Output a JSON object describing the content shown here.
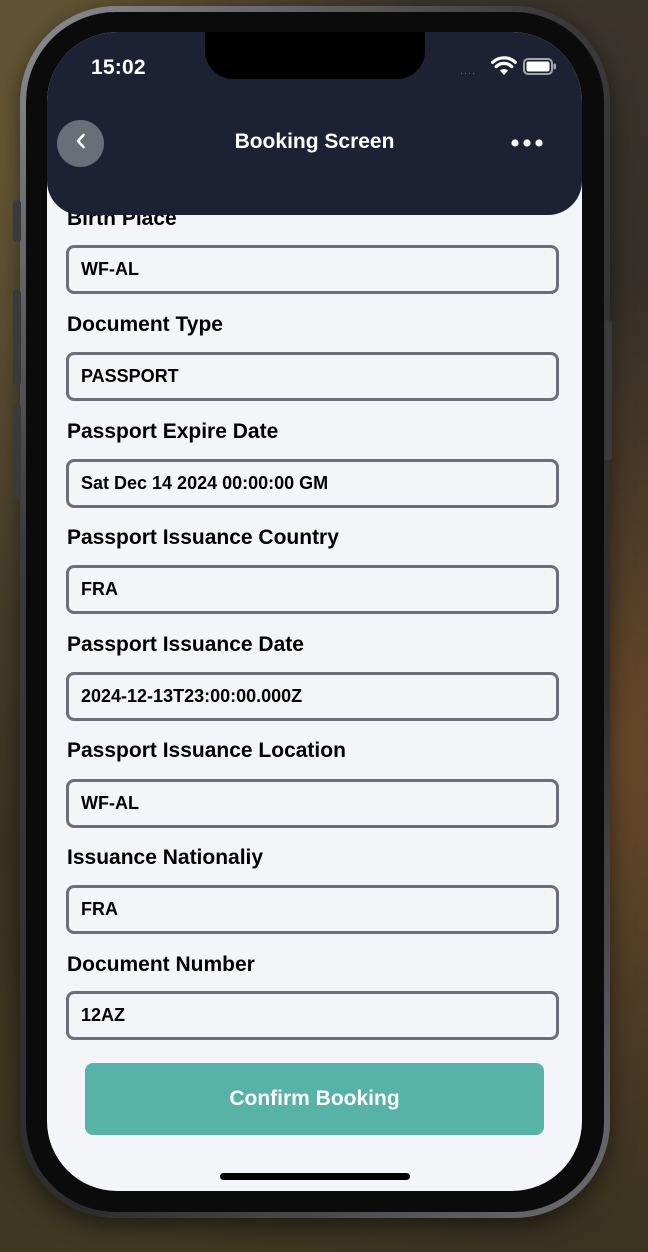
{
  "status_bar": {
    "time": "15:02",
    "signal": "....",
    "wifi_icon": "wifi-icon",
    "battery_icon": "battery-icon"
  },
  "header": {
    "title": "Booking Screen",
    "back_icon": "chevron-left-icon",
    "more_icon": "ellipsis-icon",
    "background_color": "#1c2133"
  },
  "form": {
    "fields": [
      {
        "label": "Birth Place",
        "value": "WF-AL"
      },
      {
        "label": "Document Type",
        "value": "PASSPORT"
      },
      {
        "label": "Passport Expire Date",
        "value": "Sat Dec 14 2024 00:00:00 GM"
      },
      {
        "label": "Passport Issuance Country",
        "value": "FRA"
      },
      {
        "label": "Passport Issuance Date",
        "value": "2024-12-13T23:00:00.000Z"
      },
      {
        "label": "Passport Issuance Location",
        "value": "WF-AL"
      },
      {
        "label": "Issuance Nationaliy",
        "value": "FRA"
      },
      {
        "label": "Document Number",
        "value": "12AZ"
      }
    ]
  },
  "actions": {
    "confirm_label": "Confirm Booking",
    "confirm_color": "#57b3a7"
  }
}
